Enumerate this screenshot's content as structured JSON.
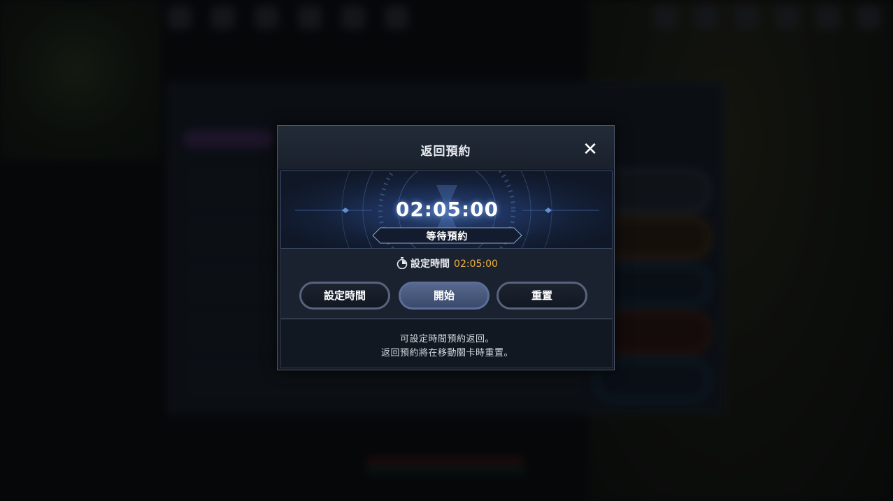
{
  "modal": {
    "title": "返回預約",
    "close_icon": "close-icon",
    "timer": {
      "value": "02:05:00",
      "status": "等待預約"
    },
    "set_time": {
      "label": "設定時間",
      "value": "02:05:00",
      "icon": "stopwatch-icon"
    },
    "buttons": {
      "set_time": "設定時間",
      "start": "開始",
      "reset": "重置"
    },
    "info": {
      "line1": "可設定時間預約返回。",
      "line2": "返回預約將在移動關卡時重置。"
    }
  },
  "colors": {
    "accent_time": "#f1b23b",
    "primary_button": "#4a5c80",
    "timer_glow": "#3a5a8e"
  }
}
